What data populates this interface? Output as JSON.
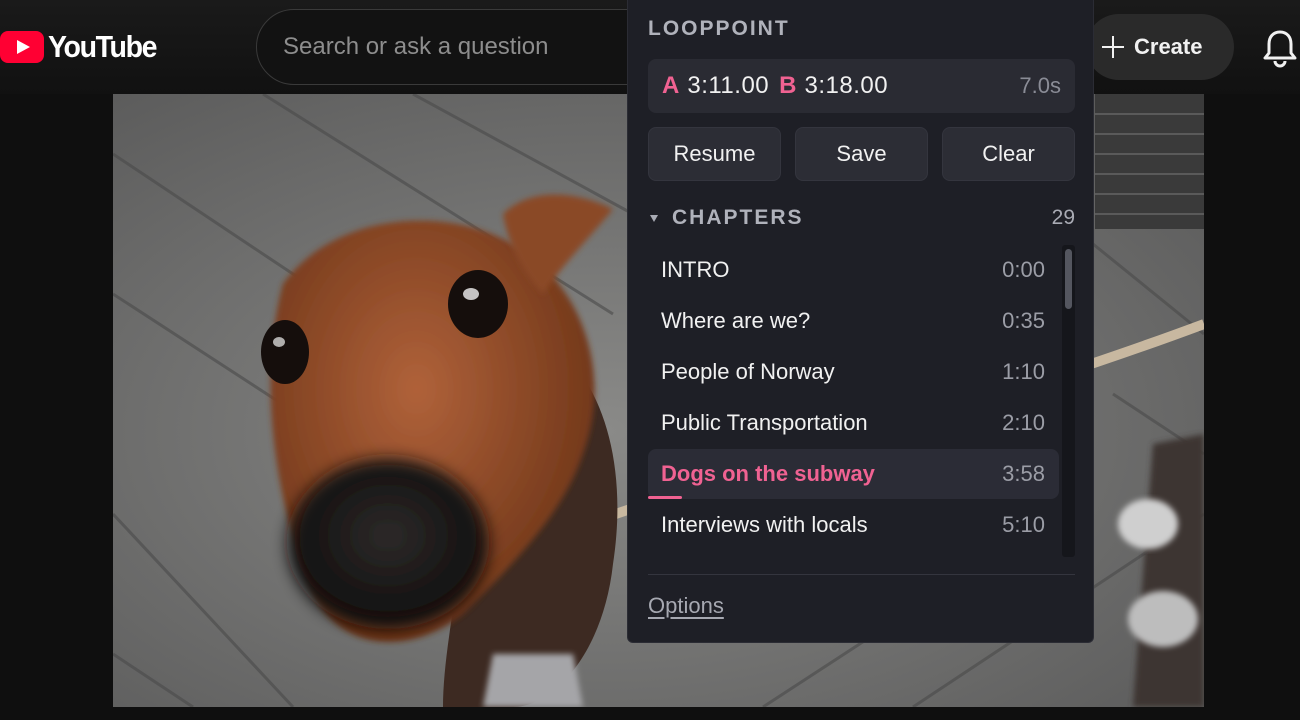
{
  "header": {
    "logo_text": "YouTube",
    "search_placeholder": "Search or ask a question",
    "create_label": "Create",
    "icons": [
      "youtube-logo",
      "plus-icon",
      "bell-icon"
    ]
  },
  "video": {
    "description_icon": "video-frame"
  },
  "looppoint": {
    "title": "LOOPPOINT",
    "a_label": "A",
    "a_time": "3:11.00",
    "b_label": "B",
    "b_time": "3:18.00",
    "duration": "7.0s",
    "buttons": {
      "resume": "Resume",
      "save": "Save",
      "clear": "Clear"
    },
    "chapters_label": "CHAPTERS",
    "chapters_count": "29",
    "chapters": [
      {
        "title": "INTRO",
        "time": "0:00"
      },
      {
        "title": "Where are we?",
        "time": "0:35"
      },
      {
        "title": "People of Norway",
        "time": "1:10"
      },
      {
        "title": "Public Transportation",
        "time": "2:10"
      },
      {
        "title": "Dogs on the subway",
        "time": "3:58",
        "active": true
      },
      {
        "title": "Interviews with locals",
        "time": "5:10"
      }
    ],
    "options_label": "Options",
    "accent_color": "#f06292"
  }
}
